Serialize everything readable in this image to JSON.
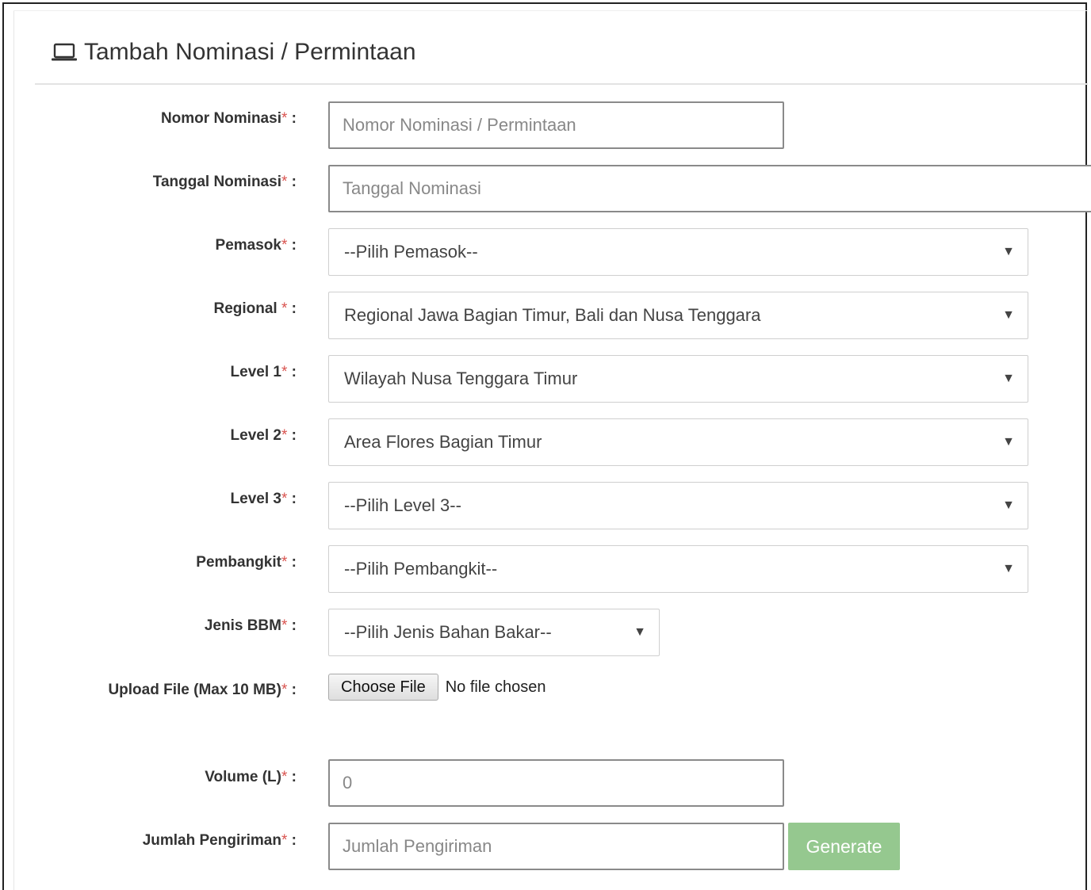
{
  "header": {
    "title": "Tambah Nominasi / Permintaan",
    "icon": "laptop-icon"
  },
  "required_marker": "*",
  "form": {
    "nomor_nominasi": {
      "label": "Nomor Nominasi",
      "suffix": " :",
      "value": "",
      "placeholder": "Nomor Nominasi / Permintaan"
    },
    "tanggal_nominasi": {
      "label": "Tanggal Nominasi",
      "suffix": " :",
      "value": "",
      "placeholder": "Tanggal Nominasi"
    },
    "pemasok": {
      "label": "Pemasok",
      "suffix": " :",
      "selected": "--Pilih Pemasok--"
    },
    "regional": {
      "label": "Regional ",
      "suffix": " :",
      "selected": "Regional Jawa Bagian Timur, Bali dan Nusa Tenggara"
    },
    "level1": {
      "label": "Level 1",
      "suffix": " :",
      "selected": "Wilayah Nusa Tenggara Timur"
    },
    "level2": {
      "label": "Level 2",
      "suffix": " :",
      "selected": "Area Flores Bagian Timur"
    },
    "level3": {
      "label": "Level 3",
      "suffix": " :",
      "selected": "--Pilih Level 3--"
    },
    "pembangkit": {
      "label": "Pembangkit",
      "suffix": " :",
      "selected": "--Pilih Pembangkit--"
    },
    "jenis_bbm": {
      "label": "Jenis BBM",
      "suffix": " :",
      "selected": "--Pilih Jenis Bahan Bakar--"
    },
    "upload": {
      "label": "Upload File (Max 10 MB)",
      "suffix": " :",
      "button_label": "Choose File",
      "status": "No file chosen"
    },
    "volume": {
      "label": "Volume (L)",
      "suffix": " :",
      "value": "",
      "placeholder": "0"
    },
    "jumlah_pengiriman": {
      "label": "Jumlah Pengiriman",
      "suffix": " :",
      "value": "",
      "placeholder": "Jumlah Pengiriman"
    }
  },
  "buttons": {
    "generate": "Generate"
  },
  "colors": {
    "required": "#d9534f",
    "generate_button": "#95c88f"
  }
}
